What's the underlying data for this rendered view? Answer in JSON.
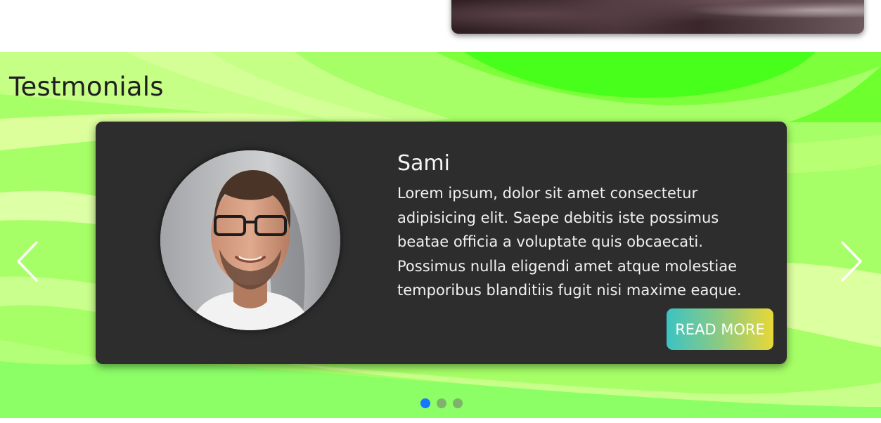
{
  "testimonials": {
    "title": "Testmonials",
    "card": {
      "name": "Sami",
      "quote": "Lorem ipsum, dolor sit amet consectetur adipisicing elit. Saepe debitis iste possimus beatae officia a voluptate quis obcaecati. Possimus nulla eligendi amet atque molestiae temporibus blanditiis fugit nisi maxime eaque.",
      "button_label": "READ MORE",
      "avatar_icon": "person-portrait"
    },
    "carousel": {
      "prev_icon": "chevron-left-icon",
      "next_icon": "chevron-right-icon",
      "slide_count": 3,
      "active_index": 0
    }
  },
  "colors": {
    "section_bg": "#a6ff66",
    "card_bg": "#2d2d2d",
    "active_dot": "#1677ff",
    "button_gradient_start": "#3cc3c3",
    "button_gradient_end": "#e8d838"
  }
}
